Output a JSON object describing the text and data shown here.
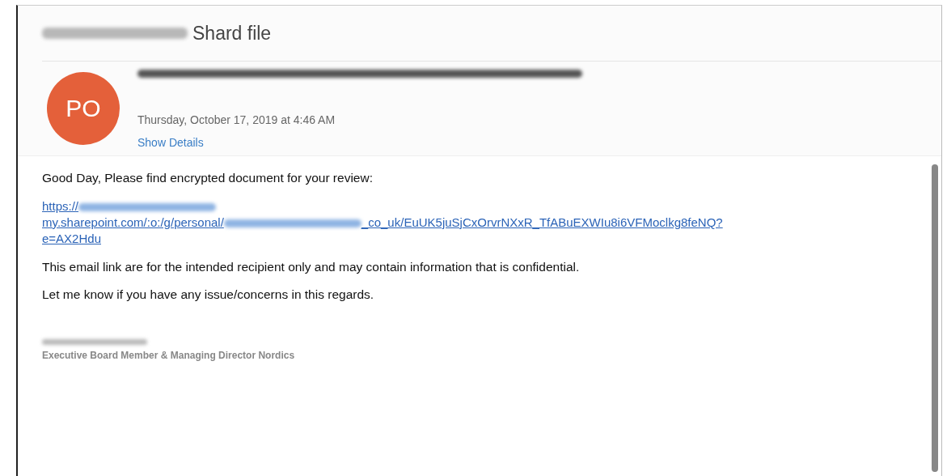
{
  "header": {
    "subject_redacted": true,
    "subject": "Shard file",
    "sender_redacted": true,
    "avatar": {
      "initials": "PO",
      "color": "#e4603a"
    },
    "date": "Thursday, October 17, 2019 at 4:46 AM",
    "show_details": "Show Details"
  },
  "body": {
    "greeting": "Good Day, Please find encrypted document for your review:",
    "link_lines": [
      [
        {
          "kind": "text",
          "text": "https://"
        },
        {
          "kind": "redacted"
        }
      ],
      [
        {
          "kind": "text",
          "text": "my.sharepoint.com/:o:/g/personal/"
        },
        {
          "kind": "redacted"
        },
        {
          "kind": "text",
          "text": "_co_uk/EuUK5juSjCxOrvrNXxR_TfABuEXWIu8i6VFMoclkg8feNQ?"
        }
      ],
      [
        {
          "kind": "text",
          "text": "e=AX2Hdu"
        }
      ]
    ],
    "paragraphs": [
      "This email link are for the intended recipient only and may contain information that is confidential.",
      "Let me know if you have any issue/concerns in this regards."
    ],
    "signature_name_redacted": true,
    "signature_title": "Executive Board Member & Managing Director Nordics"
  }
}
